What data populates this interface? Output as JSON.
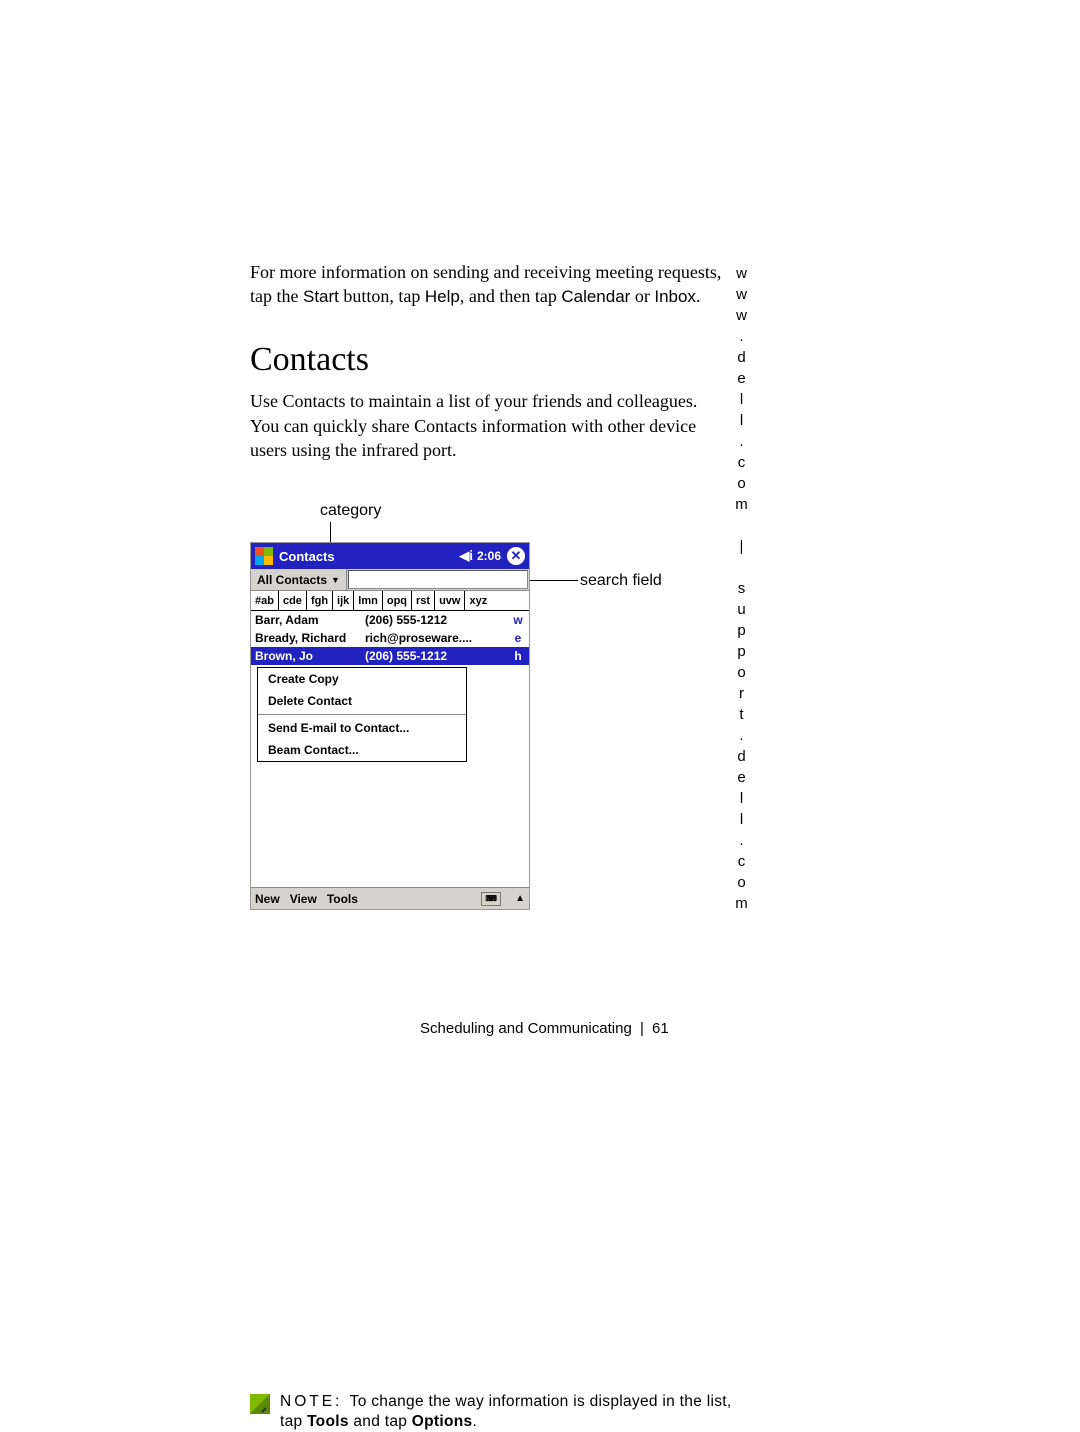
{
  "sidebar_url": "www.dell.com | support.dell.com",
  "intro": {
    "line1": "For more information on sending and receiving meeting requests, tap the ",
    "start": "Start",
    "mid1": " button, tap ",
    "help": "Help",
    "mid2": ", and then tap ",
    "calendar": "Calendar",
    "or": " or ",
    "inbox": "Inbox",
    "end": "."
  },
  "heading": "Contacts",
  "body": "Use Contacts to maintain a list of your friends and colleagues. You can quickly share Contacts information with other device users using the infrared port.",
  "callouts": {
    "category": "category",
    "search": "search field"
  },
  "device": {
    "title": "Contacts",
    "time": "2:06",
    "category_filter": "All Contacts",
    "az": [
      "#ab",
      "cde",
      "fgh",
      "ijk",
      "lmn",
      "opq",
      "rst",
      "uvw",
      "xyz"
    ],
    "rows": [
      {
        "name": "Barr, Adam",
        "value": "(206) 555-1212",
        "tag": "w",
        "sel": false
      },
      {
        "name": "Bready, Richard",
        "value": "rich@proseware....",
        "tag": "e",
        "sel": false
      },
      {
        "name": "Brown, Jo",
        "value": "(206) 555-1212",
        "tag": "h",
        "sel": true
      }
    ],
    "menu": {
      "create_copy": "Create Copy",
      "delete_contact": "Delete Contact",
      "send_email": "Send E-mail to Contact...",
      "beam": "Beam Contact..."
    },
    "bottom": {
      "new": "New",
      "view": "View",
      "tools": "Tools"
    }
  },
  "note": {
    "label": "NOTE: ",
    "t1": "To change the way information is displayed in the list, tap ",
    "tools": "Tools",
    "t2": " and tap ",
    "options": "Options",
    "t3": "."
  },
  "footer": {
    "chapter": "Scheduling and Communicating",
    "page": "61"
  }
}
